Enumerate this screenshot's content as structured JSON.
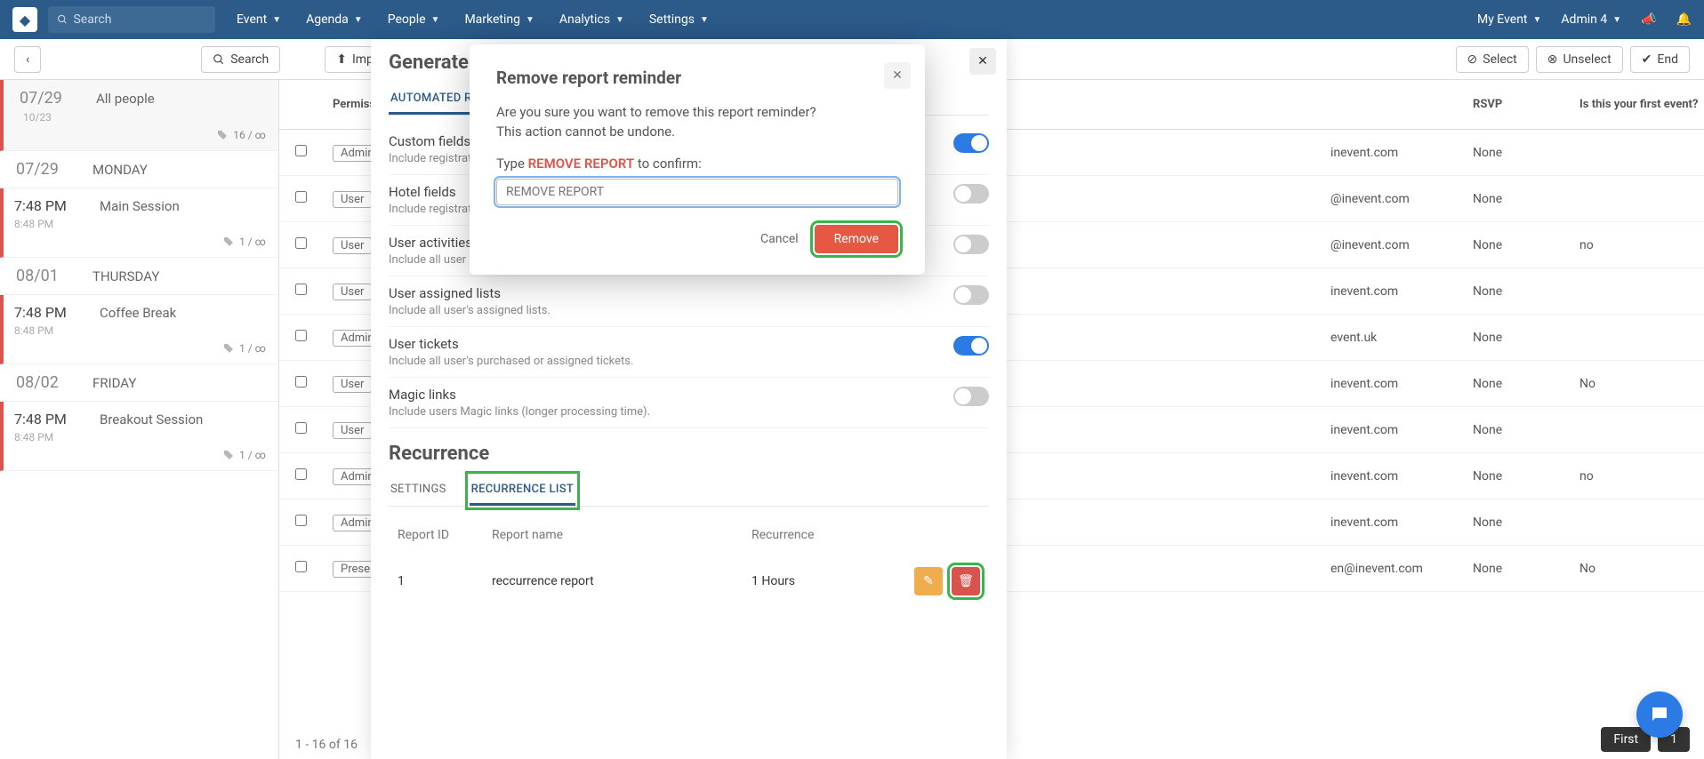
{
  "topnav": {
    "search_placeholder": "Search",
    "menu": [
      "Event",
      "Agenda",
      "People",
      "Marketing",
      "Analytics",
      "Settings"
    ],
    "my_event": "My Event",
    "admin": "Admin 4"
  },
  "toolbar": {
    "back_icon": "‹",
    "search": "Search",
    "import": "Import",
    "select": "Select",
    "unselect": "Unselect",
    "end": "End"
  },
  "sidebar": {
    "blocks": [
      {
        "type": "day",
        "date": "07/29",
        "second": "10/23",
        "name": "All people",
        "tag": "16 / ∞",
        "active": true
      },
      {
        "type": "day",
        "date": "07/29",
        "name": "MONDAY"
      },
      {
        "type": "session",
        "t1": "7:48 PM",
        "t2": "8:48 PM",
        "title": "Main Session",
        "tag": "1 / ∞"
      },
      {
        "type": "day",
        "date": "08/01",
        "name": "THURSDAY"
      },
      {
        "type": "session",
        "t1": "7:48 PM",
        "t2": "8:48 PM",
        "title": "Coffee Break",
        "tag": "1 / ∞"
      },
      {
        "type": "day",
        "date": "08/02",
        "name": "FRIDAY"
      },
      {
        "type": "session",
        "t1": "7:48 PM",
        "t2": "8:48 PM",
        "title": "Breakout Session",
        "tag": "1 / ∞"
      }
    ]
  },
  "table": {
    "head": {
      "permission": "Permission",
      "rsvp": "RSVP",
      "first": "Is this your first event?"
    },
    "rows": [
      {
        "perm": "Admin",
        "email": "inevent.com",
        "rsvp": "None",
        "first": ""
      },
      {
        "perm": "User",
        "email": "@inevent.com",
        "rsvp": "None",
        "first": ""
      },
      {
        "perm": "User",
        "email": "@inevent.com",
        "rsvp": "None",
        "first": "no"
      },
      {
        "perm": "User",
        "email": "inevent.com",
        "rsvp": "None",
        "first": ""
      },
      {
        "perm": "Admin",
        "email": "event.uk",
        "rsvp": "None",
        "first": ""
      },
      {
        "perm": "User",
        "email": "inevent.com",
        "rsvp": "None",
        "first": "No"
      },
      {
        "perm": "User",
        "email": "inevent.com",
        "rsvp": "None",
        "first": ""
      },
      {
        "perm": "Admin",
        "email": "inevent.com",
        "rsvp": "None",
        "first": "no"
      },
      {
        "perm": "Admin",
        "email": "inevent.com",
        "rsvp": "None",
        "first": ""
      },
      {
        "perm": "Presente",
        "email": "en@inevent.com",
        "rsvp": "None",
        "first": "No"
      }
    ],
    "pager": "1 - 16 of 16",
    "first": "First",
    "page": "1"
  },
  "panel": {
    "title": "Generate r",
    "tab_auto": "AUTOMATED R",
    "recurrence_heading": "Recurrence",
    "tab_settings": "SETTINGS",
    "tab_reclist": "RECURRENCE LIST",
    "options": [
      {
        "title": "Custom fields",
        "desc": "Include registrati",
        "on": true
      },
      {
        "title": "Hotel fields",
        "desc": "Include registrati",
        "on": false
      },
      {
        "title": "User activities",
        "desc": "Include all user a",
        "on": false
      },
      {
        "title": "User assigned lists",
        "desc": "Include all user's assigned lists.",
        "on": false
      },
      {
        "title": "User tickets",
        "desc": "Include all user's purchased or assigned tickets.",
        "on": true
      },
      {
        "title": "Magic links",
        "desc": "Include users Magic links (longer processing time).",
        "on": false
      }
    ],
    "rec_head": {
      "id": "Report ID",
      "name": "Report name",
      "rec": "Recurrence"
    },
    "rec_row": {
      "id": "1",
      "name": "reccurrence report",
      "rec": "1 Hours"
    }
  },
  "modal": {
    "title": "Remove report reminder",
    "line1": "Are you sure you want to remove this report reminder?",
    "line2": "This action cannot be undone.",
    "type_prefix": "Type ",
    "type_strong": "REMOVE REPORT",
    "type_suffix": " to confirm:",
    "placeholder": "REMOVE REPORT",
    "cancel": "Cancel",
    "remove": "Remove"
  }
}
